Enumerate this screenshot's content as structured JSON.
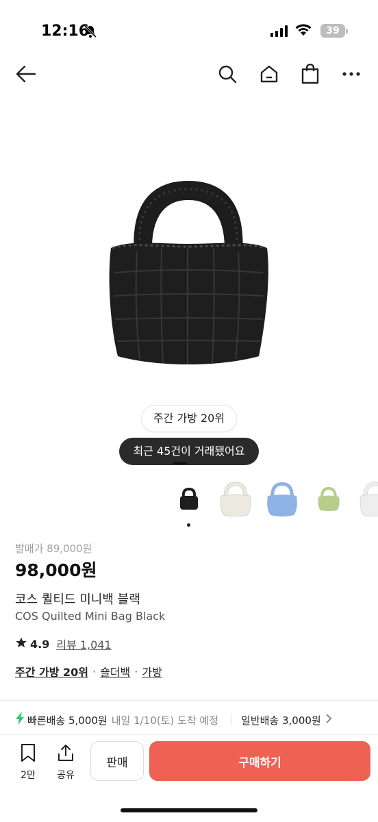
{
  "status": {
    "time": "12:16",
    "battery": "39"
  },
  "product": {
    "rank_badge": "주간 가방 20위",
    "trade_count": "최근 45건이 거래됐어요",
    "original_price": "발매가 89,000원",
    "price": "98,000원",
    "title_ko": "코스 퀼티드 미니백 블랙",
    "title_en": "COS Quilted Mini Bag Black",
    "rating": "4.9",
    "review_link": "리뷰 1,041",
    "categories": [
      "주간 가방 20위",
      "숄더백",
      "가방"
    ],
    "thumbnail_colors": [
      "#1e1e1e",
      "#ece9e0",
      "#8fb2e6",
      "#b6cd8c",
      "#e9e9e9"
    ]
  },
  "shipping": {
    "fast": "빠른배송 5,000원",
    "eta": "내일 1/10(토) 도착 예정",
    "normal": "일반배송 3,000원",
    "accent": "#31c46e"
  },
  "bottom": {
    "likes": "2만",
    "share": "공유",
    "sell": "판매",
    "buy": "구매하기",
    "buy_color": "#ef6253"
  }
}
